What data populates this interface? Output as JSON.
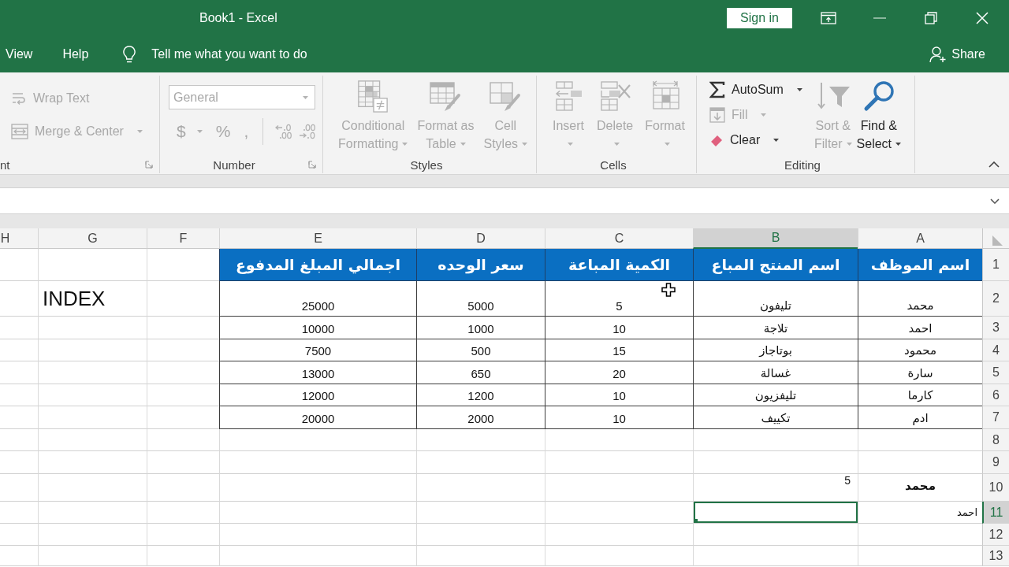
{
  "window": {
    "title": "Book1 - Excel",
    "sign_in": "Sign in"
  },
  "menu": {
    "tabs": [
      {
        "label": "Help",
        "selected": false
      },
      {
        "label": "View",
        "selected": false
      }
    ],
    "tell_me": "Tell me what you want to do",
    "share": "Share"
  },
  "ribbon": {
    "groups": [
      {
        "label": "Editing",
        "clipped": false,
        "launcher": false,
        "items": [
          {
            "kind": "large",
            "lines": [
              "Find &",
              "Select"
            ],
            "disabled": false,
            "dropdown": true
          },
          {
            "kind": "large",
            "lines": [
              "Sort &",
              "Filter"
            ],
            "disabled": true,
            "dropdown": true
          },
          {
            "kind": "small",
            "label": "AutoSum",
            "disabled": false,
            "dropdown": true
          },
          {
            "kind": "small",
            "label": "Fill",
            "disabled": true,
            "dropdown": true
          },
          {
            "kind": "small",
            "label": "Clear",
            "disabled": false,
            "dropdown": true
          }
        ]
      },
      {
        "label": "Cells",
        "clipped": false,
        "launcher": false,
        "items": [
          {
            "kind": "large",
            "lines": [
              "Format"
            ],
            "disabled": true,
            "dropdown": true
          },
          {
            "kind": "large",
            "lines": [
              "Delete"
            ],
            "disabled": true,
            "dropdown": true
          },
          {
            "kind": "large",
            "lines": [
              "Insert"
            ],
            "disabled": true,
            "dropdown": true
          }
        ]
      },
      {
        "label": "Styles",
        "clipped": false,
        "launcher": false,
        "items": [
          {
            "kind": "large",
            "lines": [
              "Cell",
              "Styles"
            ],
            "disabled": true,
            "dropdown": true
          },
          {
            "kind": "large",
            "lines": [
              "Format as",
              "Table"
            ],
            "disabled": true,
            "dropdown": true
          },
          {
            "kind": "large",
            "lines": [
              "Conditional",
              "Formatting"
            ],
            "disabled": true,
            "dropdown": true
          }
        ]
      },
      {
        "label": "Number",
        "clipped": false,
        "launcher": true,
        "items": [
          {
            "kind": "combo",
            "value": "General",
            "disabled": true
          },
          {
            "kind": "icon",
            "disabled": true
          },
          {
            "kind": "icon",
            "disabled": true
          },
          {
            "kind": "symbol",
            "label": ",",
            "disabled": true,
            "dropdown": false
          },
          {
            "kind": "symbol",
            "label": "%",
            "disabled": true,
            "dropdown": false
          },
          {
            "kind": "symbol",
            "label": "$",
            "disabled": true,
            "dropdown": true
          }
        ]
      },
      {
        "label": "nt",
        "clipped": true,
        "launcher": true,
        "items": [
          {
            "kind": "small",
            "label": "Wrap Text",
            "disabled": true,
            "dropdown": false
          },
          {
            "kind": "small",
            "label": "Merge & Center",
            "disabled": true,
            "dropdown": true
          }
        ]
      }
    ]
  },
  "sheet": {
    "columns": [
      {
        "label": "A",
        "selected": false
      },
      {
        "label": "B",
        "selected": true
      },
      {
        "label": "C",
        "selected": false
      },
      {
        "label": "D",
        "selected": false
      },
      {
        "label": "E",
        "selected": false
      },
      {
        "label": "F",
        "selected": false
      },
      {
        "label": "G",
        "selected": false
      },
      {
        "label": "H",
        "selected": false
      }
    ],
    "rows": [
      {
        "label": "1",
        "selected": false,
        "cells": [
          {
            "text": "اسم الموظف",
            "kind": "table-head"
          },
          {
            "text": "اسم المنتج المباع",
            "kind": "table-head"
          },
          {
            "text": "الكمية المباعة",
            "kind": "table-head"
          },
          {
            "text": "سعر الوحده",
            "kind": "table-head"
          },
          {
            "text": "اجمالي المبلغ المدفوع",
            "kind": "table-head"
          }
        ]
      },
      {
        "label": "2",
        "selected": false,
        "cells": [
          {
            "text": "محمد",
            "kind": "table"
          },
          {
            "text": "تليفون",
            "kind": "table"
          },
          {
            "text": "5",
            "kind": "table"
          },
          {
            "text": "5000",
            "kind": "table"
          },
          {
            "text": "25000",
            "kind": "table"
          },
          null,
          {
            "text": "INDEX",
            "kind": "large"
          }
        ]
      },
      {
        "label": "3",
        "selected": false,
        "cells": [
          {
            "text": "احمد",
            "kind": "table"
          },
          {
            "text": "تلاجة",
            "kind": "table"
          },
          {
            "text": "10",
            "kind": "table"
          },
          {
            "text": "1000",
            "kind": "table"
          },
          {
            "text": "10000",
            "kind": "table"
          }
        ]
      },
      {
        "label": "4",
        "selected": false,
        "cells": [
          {
            "text": "محمود",
            "kind": "table"
          },
          {
            "text": "بوتاجاز",
            "kind": "table"
          },
          {
            "text": "15",
            "kind": "table"
          },
          {
            "text": "500",
            "kind": "table"
          },
          {
            "text": "7500",
            "kind": "table"
          }
        ]
      },
      {
        "label": "5",
        "selected": false,
        "cells": [
          {
            "text": "سارة",
            "kind": "table"
          },
          {
            "text": "غسالة",
            "kind": "table"
          },
          {
            "text": "20",
            "kind": "table"
          },
          {
            "text": "650",
            "kind": "table"
          },
          {
            "text": "13000",
            "kind": "table"
          }
        ]
      },
      {
        "label": "6",
        "selected": false,
        "cells": [
          {
            "text": "كارما",
            "kind": "table"
          },
          {
            "text": "تليفزيون",
            "kind": "table"
          },
          {
            "text": "10",
            "kind": "table"
          },
          {
            "text": "1200",
            "kind": "table"
          },
          {
            "text": "12000",
            "kind": "table"
          }
        ]
      },
      {
        "label": "7",
        "selected": false,
        "cells": [
          {
            "text": "ادم",
            "kind": "table"
          },
          {
            "text": "تكييف",
            "kind": "table"
          },
          {
            "text": "10",
            "kind": "table"
          },
          {
            "text": "2000",
            "kind": "table"
          },
          {
            "text": "20000",
            "kind": "table"
          }
        ]
      },
      {
        "label": "8",
        "selected": false
      },
      {
        "label": "9",
        "selected": false
      },
      {
        "label": "10",
        "selected": false,
        "cells": [
          {
            "text": "محمد",
            "kind": "bold"
          },
          {
            "text": "5",
            "kind": "value"
          }
        ]
      },
      {
        "label": "11",
        "selected": true,
        "cells": [
          {
            "text": "احمد",
            "kind": "plain"
          }
        ]
      },
      {
        "label": "12",
        "selected": false
      },
      {
        "label": "13",
        "selected": false
      }
    ]
  }
}
